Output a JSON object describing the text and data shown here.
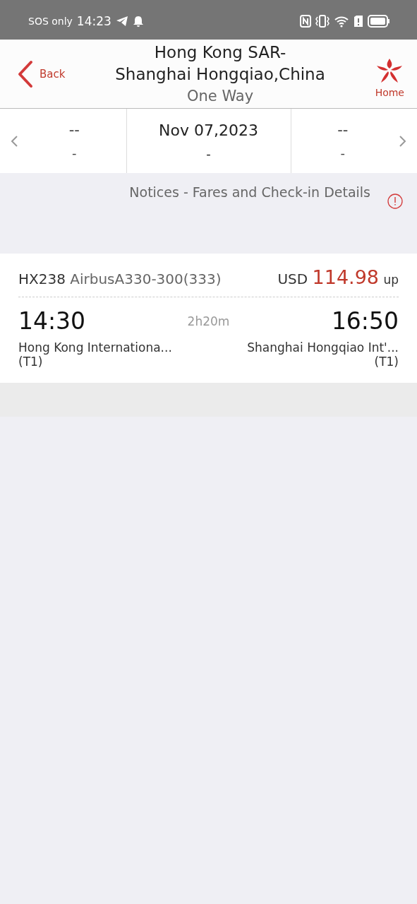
{
  "status_bar": {
    "carrier": "SOS only",
    "time": "14:23"
  },
  "header": {
    "back": "Back",
    "title_line_1": "Hong Kong SAR-",
    "title_line_2": "Shanghai Hongqiao,China",
    "subtitle": "One Way",
    "home": "Home"
  },
  "dates": [
    {
      "top": "--",
      "bottom": "-",
      "selected": false
    },
    {
      "top": "Nov 07,2023",
      "bottom": "-",
      "selected": true
    },
    {
      "top": "--",
      "bottom": "-",
      "selected": false
    }
  ],
  "notice": "Notices - Fares and Check-in Details",
  "flights": [
    {
      "number": "HX238",
      "aircraft": "AirbusA330-300(333)",
      "currency": "USD",
      "price": "114.98",
      "price_suffix": "up",
      "depart_time": "14:30",
      "duration": "2h20m",
      "arrive_time": "16:50",
      "depart_airport": "Hong Kong Internationa...",
      "depart_terminal": "(T1)",
      "arrive_airport": "Shanghai Hongqiao Int'...",
      "arrive_terminal": "(T1)"
    }
  ]
}
